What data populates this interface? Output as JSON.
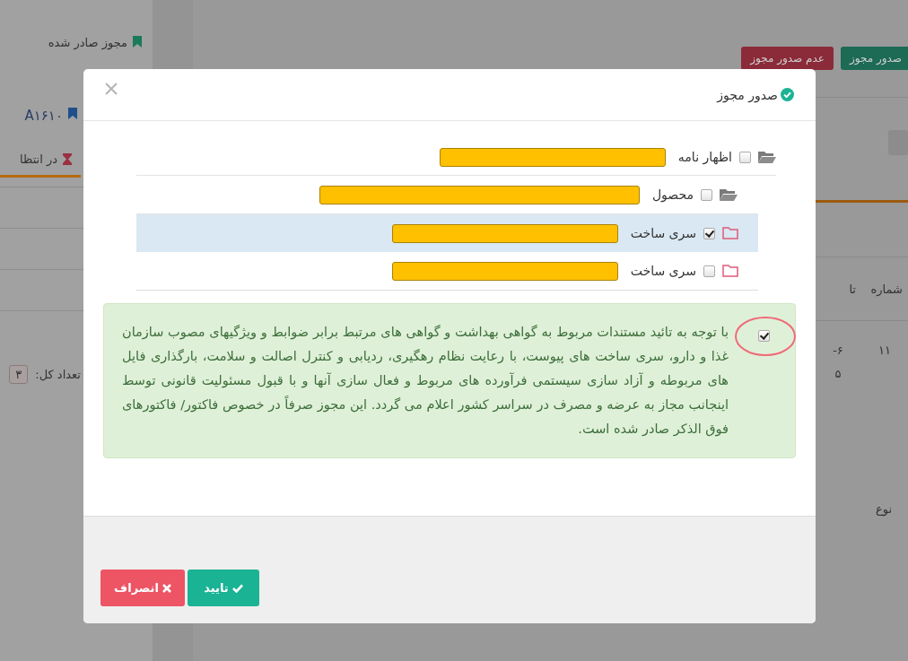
{
  "sidebar": {
    "items": [
      {
        "label": "مجوز صادر شده",
        "color": "#1a7a5a"
      },
      {
        "label": "A۱۶۱۰",
        "color": "#1f4f8a"
      }
    ],
    "tab": {
      "label": "در انتظا",
      "selected": true
    },
    "total": {
      "label": "تعداد کل:",
      "value": "۳"
    }
  },
  "toolbar": {
    "buttons": [
      {
        "label": "صدور مجوز",
        "kind": "issue"
      },
      {
        "label": "عدم صدور مجوز",
        "kind": "reject"
      }
    ]
  },
  "table": {
    "columns": [
      "شماره",
      "تا"
    ],
    "rows": [
      [
        "۱۱",
        "۶-\n۵"
      ]
    ]
  },
  "bottom_table": {
    "columns": [
      "نوع"
    ]
  },
  "modal": {
    "title": "صدور مجوز",
    "tree": [
      {
        "label": "اظهار نامه",
        "checked": false,
        "expanded": true,
        "children": [
          {
            "label": "محصول",
            "checked": false,
            "expanded": true,
            "children": [
              {
                "label": "سری ساخت",
                "checked": true,
                "selected": true
              },
              {
                "label": "سری ساخت",
                "checked": false,
                "selected": false
              }
            ]
          }
        ]
      }
    ],
    "agreement": {
      "checked": true,
      "text": "با توجه به تائید مستندات مربوط به گواهی بهداشت و گواهی های مرتبط برابر ضوابط و ویژگیهای مصوب سازمان غذا و دارو، سری ساخت های پیوست، با رعایت نظام رهگیری، ردیابی و کنترل اصالت و سلامت، بارگذاری فایل های مربوطه و آزاد سازی سیستمی فرآورده های مربوط و فعال سازی آنها و با قبول مسئولیت قانونی توسط اینجانب مجاز به عرضه و مصرف در سراسر کشور اعلام می گردد. این مجوز صرفاً در خصوص فاکتور/ فاکتورهای فوق الذکر صادر شده است."
    },
    "buttons": [
      {
        "label": "تایید",
        "kind": "confirm"
      },
      {
        "label": "انصراف",
        "kind": "cancel"
      }
    ]
  }
}
